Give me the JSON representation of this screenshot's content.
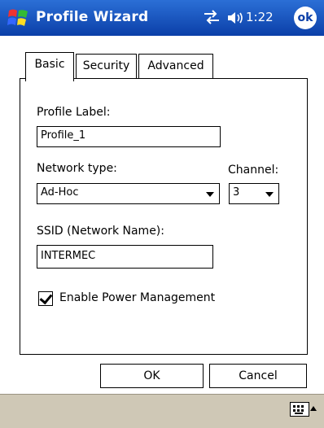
{
  "titlebar": {
    "title": "Profile Wizard",
    "time": "1:22",
    "ok_label": "ok",
    "signal_icon": "connectivity-icon",
    "volume_icon": "volume-icon"
  },
  "tabs": [
    {
      "label": "Basic",
      "active": true
    },
    {
      "label": "Security",
      "active": false
    },
    {
      "label": "Advanced",
      "active": false
    }
  ],
  "form": {
    "profile_label": "Profile Label:",
    "profile_value": "Profile_1",
    "network_type_label": "Network type:",
    "network_type_value": "Ad-Hoc",
    "channel_label": "Channel:",
    "channel_value": "3",
    "ssid_label": "SSID (Network Name):",
    "ssid_value": "INTERMEC",
    "power_mgmt_label": "Enable Power Management",
    "power_mgmt_checked": true
  },
  "buttons": {
    "ok": "OK",
    "cancel": "Cancel"
  },
  "colors": {
    "titlebar_top": "#2b6fd6",
    "titlebar_bottom": "#0b3fa8",
    "menubar": "#cfc8b6"
  }
}
